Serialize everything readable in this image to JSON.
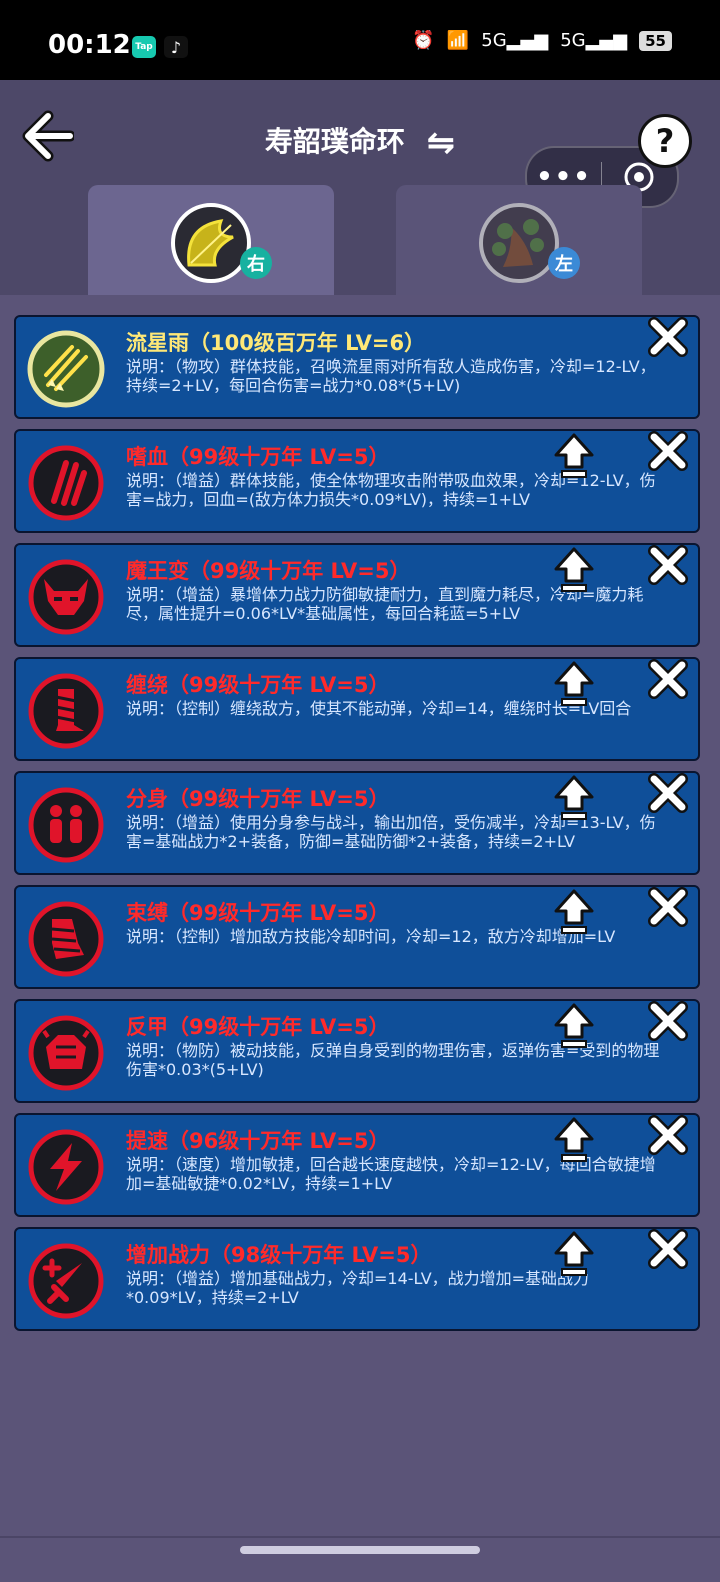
{
  "status_bar": {
    "time": "00:12",
    "apps": [
      {
        "name": "taptap-icon",
        "label": "Tap",
        "color": "#17c9b0"
      },
      {
        "name": "tiktok-icon",
        "label": "♪",
        "color": "#111111"
      }
    ],
    "signal_1": "5G",
    "signal_2": "5G",
    "battery": "55"
  },
  "header": {
    "title": "寿韶璞命环",
    "swap_symbol": "⇋",
    "help_label": "?",
    "capsule_menu": "•••"
  },
  "tabs": [
    {
      "badge": "右",
      "active": true,
      "icon": "bow-icon"
    },
    {
      "badge": "左",
      "active": false,
      "icon": "branch-icon"
    }
  ],
  "skills": [
    {
      "name": "流星雨（100级百万年 LV=6）",
      "desc": "说明：（物攻）群体技能，召唤流星雨对所有敌人造成伤害，冷却=12-LV，持续=2+LV，每回合伤害=战力*0.08*(5+LV)",
      "icon": "meteor-icon",
      "color": "gold",
      "upgradable": false
    },
    {
      "name": "嗜血（99级十万年 LV=5）",
      "desc": "说明：（增益）群体技能，使全体物理攻击附带吸血效果，冷却=12-LV，伤害=战力，回血=(敌方体力损失*0.09*LV)，持续=1+LV",
      "icon": "claw-icon",
      "color": "red",
      "upgradable": true
    },
    {
      "name": "魔王变（99级十万年 LV=5）",
      "desc": "说明：（增益）暴增体力战力防御敏捷耐力，直到魔力耗尽，冷却=魔力耗尽，属性提升=0.06*LV*基础属性，每回合耗蓝=5+LV",
      "icon": "demon-mask-icon",
      "color": "red",
      "upgradable": true
    },
    {
      "name": "缠绕（99级十万年 LV=5）",
      "desc": "说明：（控制）缠绕敌方，使其不能动弹，冷却=14，缠绕时长=LV回合",
      "icon": "vine-icon",
      "color": "red",
      "upgradable": true
    },
    {
      "name": "分身（99级十万年 LV=5）",
      "desc": "说明：（增益）使用分身参与战斗，输出加倍，受伤减半，冷却=13-LV，伤害=基础战力*2+装备，防御=基础防御*2+装备，持续=2+LV",
      "icon": "clone-icon",
      "color": "red",
      "upgradable": true
    },
    {
      "name": "束缚（99级十万年 LV=5）",
      "desc": "说明：（控制）增加敌方技能冷却时间，冷却=12，敌方冷却增加=LV",
      "icon": "bind-icon",
      "color": "red",
      "upgradable": true
    },
    {
      "name": "反甲（99级十万年 LV=5）",
      "desc": "说明：（物防）被动技能，反弹自身受到的物理伤害，返弹伤害=受到的物理伤害*0.03*(5+LV)",
      "icon": "armor-icon",
      "color": "red",
      "upgradable": true
    },
    {
      "name": "提速（96级十万年 LV=5）",
      "desc": "说明：（速度）增加敏捷，回合越长速度越快，冷却=12-LV，每回合敏捷增加=基础敏捷*0.02*LV，持续=1+LV",
      "icon": "lightning-icon",
      "color": "red",
      "upgradable": true
    },
    {
      "name": "增加战力（98级十万年 LV=5）",
      "desc": "说明：（增益）增加基础战力，冷却=14-LV，战力增加=基础战力*0.09*LV，持续=2+LV",
      "icon": "sword-plus-icon",
      "color": "red",
      "upgradable": true
    }
  ],
  "colors": {
    "card_bg": "#0f4f99",
    "skill_name_red": "#ff2a2a",
    "skill_name_gold": "#ffe877",
    "icon_ring_red": "#e0142a",
    "page_bg": "#5b5478"
  }
}
